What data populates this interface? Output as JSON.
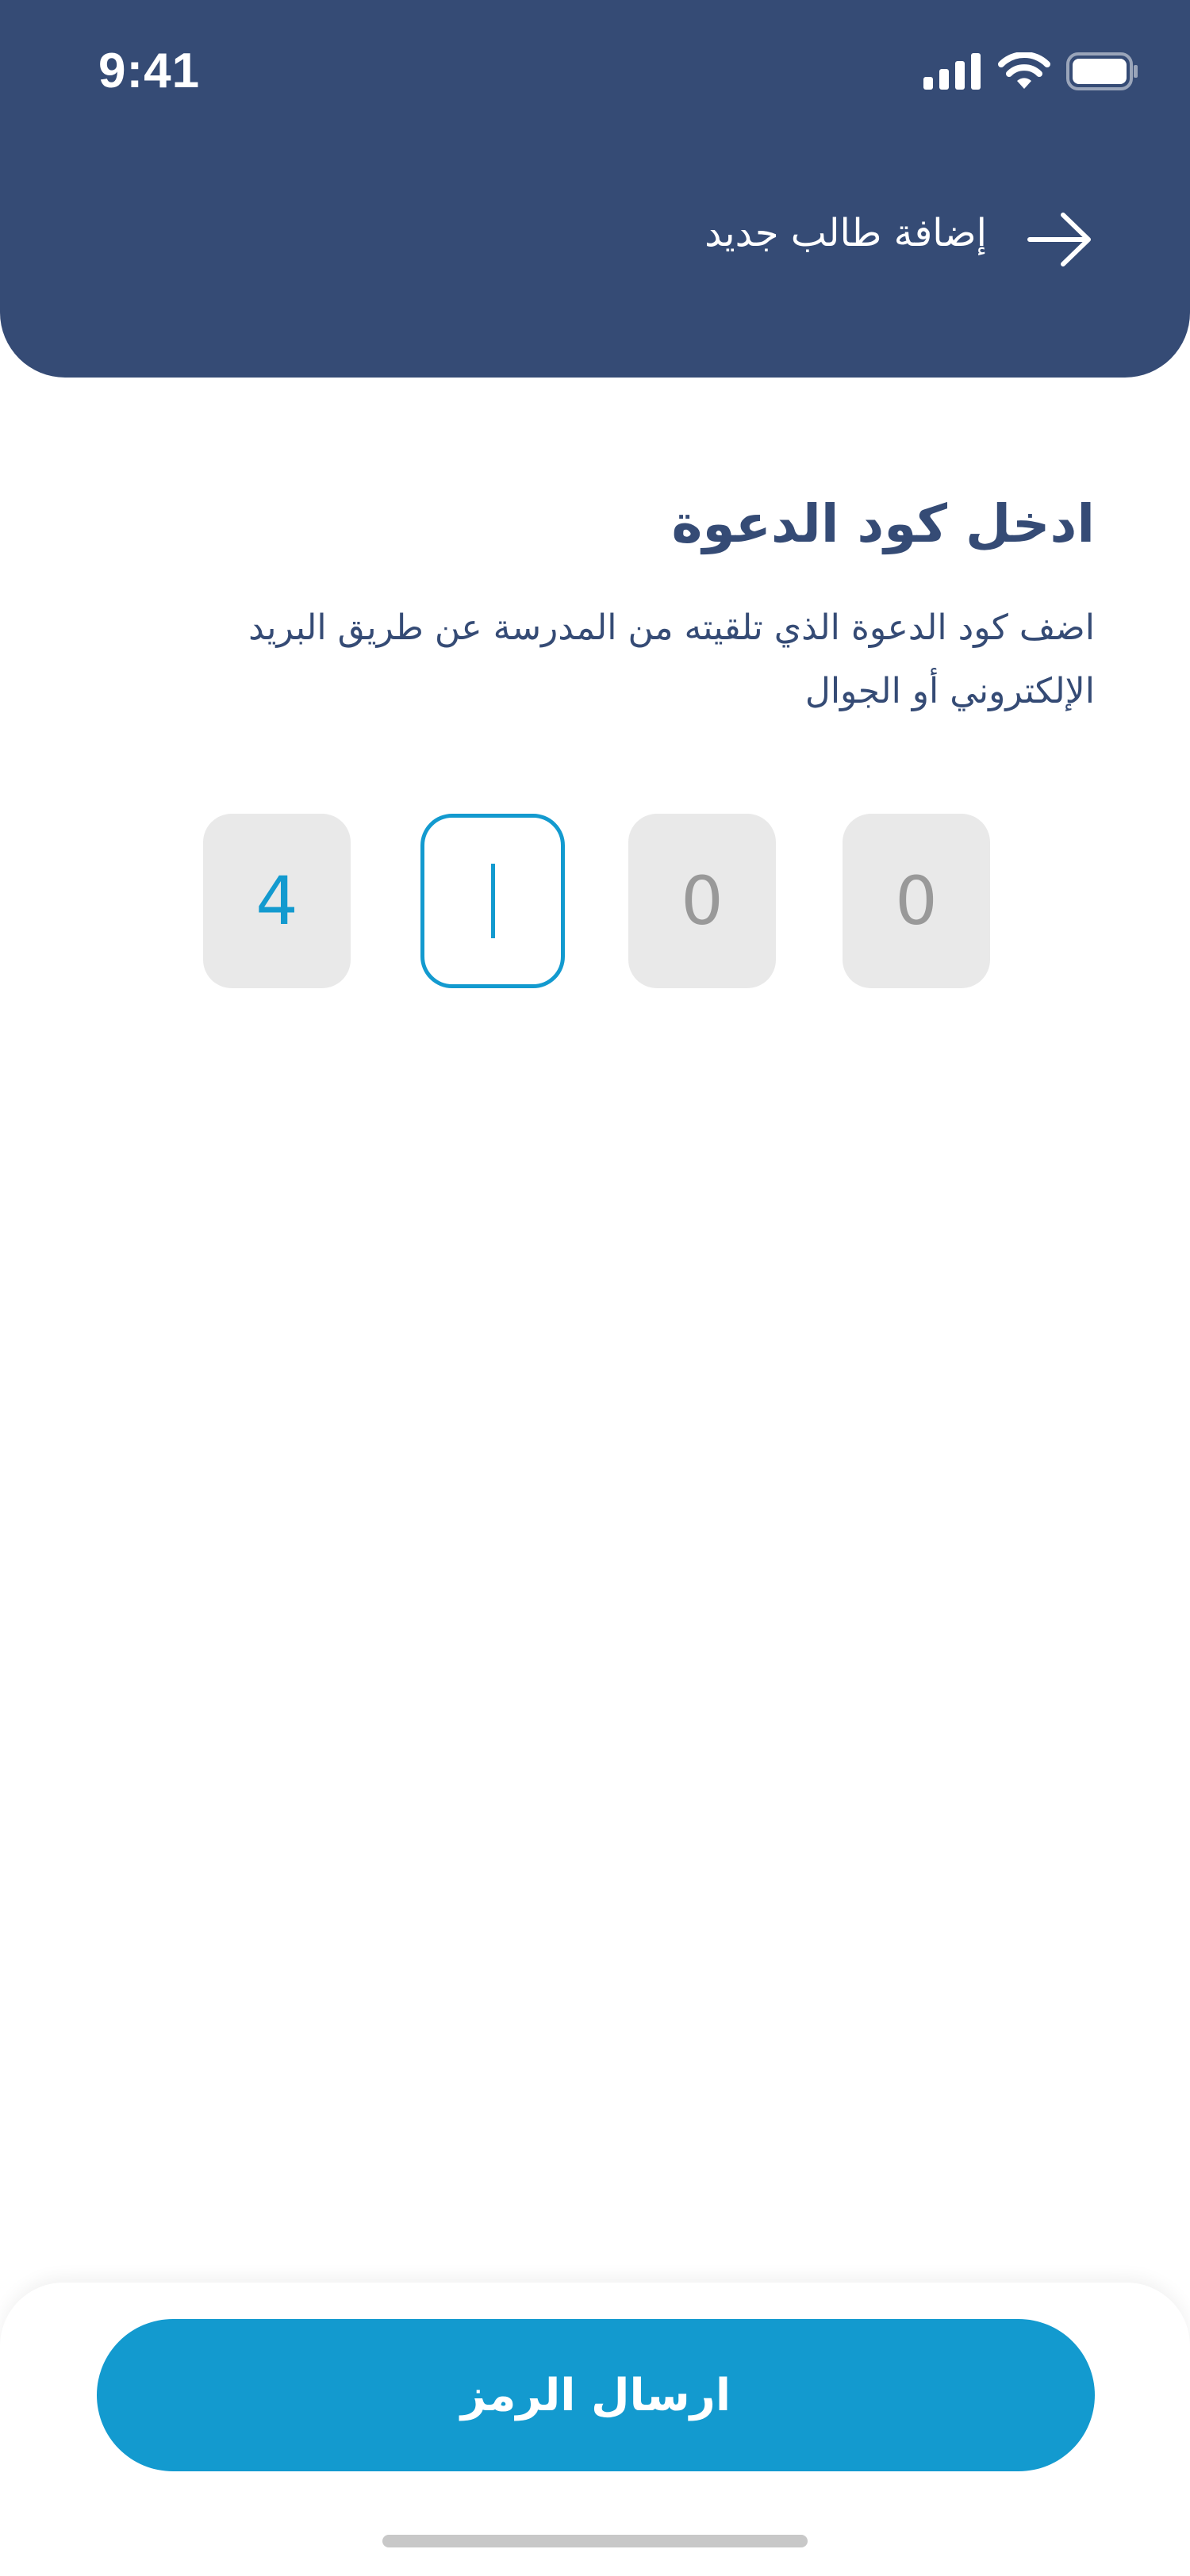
{
  "status_bar": {
    "time": "9:41",
    "icons": [
      "cellular-signal-icon",
      "wifi-icon",
      "battery-icon"
    ]
  },
  "header": {
    "title": "إضافة طالب جديد",
    "back_icon": "arrow-right-icon"
  },
  "content": {
    "title": "ادخل كود الدعوة",
    "description": "اضف كود الدعوة الذي تلقيته من المدرسة عن طريق البريد الإلكتروني أو الجوال"
  },
  "code_input": {
    "digits": [
      {
        "value": "4",
        "state": "filled"
      },
      {
        "value": "",
        "state": "active"
      },
      {
        "value": "0",
        "state": "placeholder"
      },
      {
        "value": "0",
        "state": "placeholder"
      }
    ]
  },
  "actions": {
    "submit_label": "ارسال الرمز"
  },
  "colors": {
    "header_bg": "#354b75",
    "accent": "#139acf",
    "text_primary": "#354b75",
    "box_bg": "#e9e9e9",
    "placeholder": "#999999"
  }
}
